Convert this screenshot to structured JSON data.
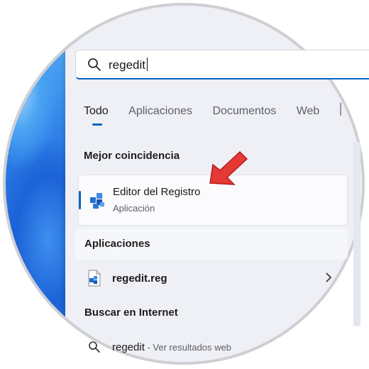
{
  "search": {
    "query": "regedit"
  },
  "tabs": [
    {
      "label": "Todo"
    },
    {
      "label": "Aplicaciones"
    },
    {
      "label": "Documentos"
    },
    {
      "label": "Web"
    }
  ],
  "best_match": {
    "header": "Mejor coincidencia",
    "title": "Editor del Registro",
    "subtitle": "Aplicación",
    "icon": "registry-editor-icon"
  },
  "apps": {
    "header": "Aplicaciones",
    "items": [
      {
        "label": "regedit.reg",
        "icon": "registry-file-icon"
      }
    ]
  },
  "internet": {
    "header": "Buscar en Internet",
    "items": [
      {
        "label": "regedit",
        "sublabel": " - Ver resultados web"
      }
    ]
  },
  "colors": {
    "accent": "#0067c0",
    "arrow": "#e53935"
  }
}
